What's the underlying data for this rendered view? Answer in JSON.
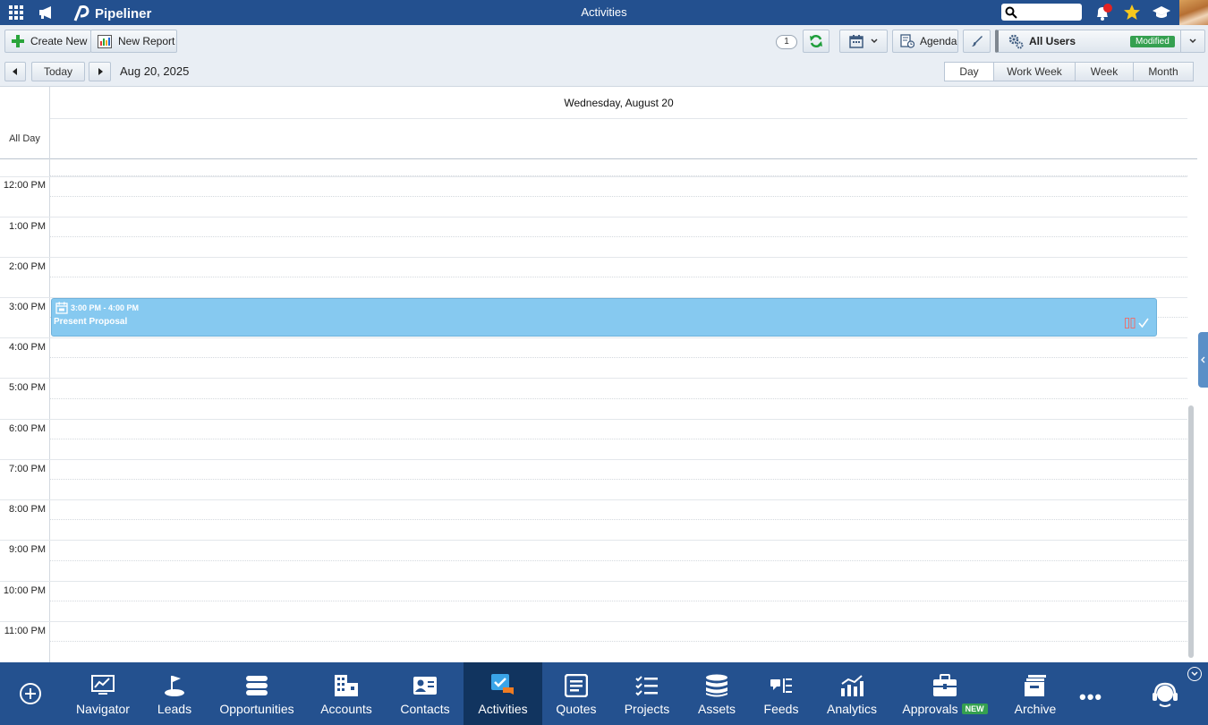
{
  "topbar": {
    "app_name": "Pipeliner",
    "title": "Activities",
    "search": {
      "placeholder": ""
    },
    "icons": [
      "apps-grid-icon",
      "megaphone-icon",
      "pipeliner-logo",
      "search-icon",
      "bell-icon",
      "star-icon",
      "graduation-cap-icon",
      "avatar"
    ]
  },
  "toolbar": {
    "create_new": "Create New",
    "new_report": "New Report",
    "count": "1",
    "agenda": "Agenda",
    "filter": "All Users",
    "filter_badge": "Modified"
  },
  "navbar": {
    "today": "Today",
    "current_date": "Aug 20, 2025",
    "views": [
      {
        "label": "Day",
        "active": true
      },
      {
        "label": "Work Week",
        "active": false
      },
      {
        "label": "Week",
        "active": false
      },
      {
        "label": "Month",
        "active": false
      }
    ]
  },
  "calendar": {
    "day_header": "Wednesday, August 20",
    "all_day_label": "All Day",
    "time_labels": [
      "12:00 PM",
      "1:00 PM",
      "2:00 PM",
      "3:00 PM",
      "4:00 PM",
      "5:00 PM",
      "6:00 PM",
      "7:00 PM",
      "8:00 PM",
      "9:00 PM",
      "10:00 PM",
      "11:00 PM"
    ],
    "event": {
      "time": "3:00 PM - 4:00 PM",
      "subject": "Present Proposal",
      "color": "#86c9f0"
    }
  },
  "bottom_nav": {
    "items": [
      {
        "label": "Navigator",
        "icon": "navigator-icon"
      },
      {
        "label": "Leads",
        "icon": "leads-icon"
      },
      {
        "label": "Opportunities",
        "icon": "opportunities-icon"
      },
      {
        "label": "Accounts",
        "icon": "accounts-icon"
      },
      {
        "label": "Contacts",
        "icon": "contacts-icon"
      },
      {
        "label": "Activities",
        "icon": "activities-icon",
        "active": true
      },
      {
        "label": "Quotes",
        "icon": "quotes-icon"
      },
      {
        "label": "Projects",
        "icon": "projects-icon"
      },
      {
        "label": "Assets",
        "icon": "assets-icon"
      },
      {
        "label": "Feeds",
        "icon": "feeds-icon"
      },
      {
        "label": "Analytics",
        "icon": "analytics-icon"
      },
      {
        "label": "Approvals",
        "icon": "approvals-icon",
        "badge": "NEW"
      },
      {
        "label": "Archive",
        "icon": "archive-icon"
      }
    ],
    "more": "•••"
  },
  "colors": {
    "header_blue": "#23508f",
    "active_nav": "#11345f",
    "event_blue": "#86c9f0",
    "badge_green": "#35a050"
  }
}
